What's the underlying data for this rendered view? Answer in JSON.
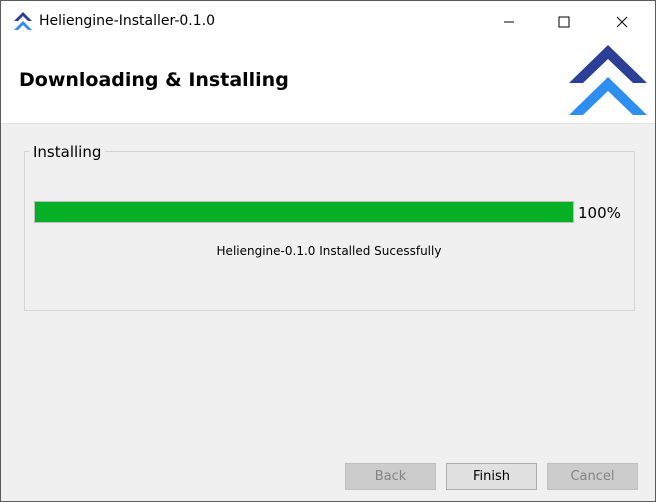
{
  "window": {
    "title": "Heliengine-Installer-0.1.0",
    "controls": {
      "minimize": "minimize-icon",
      "maximize": "maximize-icon",
      "close": "close-icon"
    }
  },
  "header": {
    "title": "Downloading & Installing",
    "logo": "heliengine-logo",
    "logo_colors": {
      "top": "#2b3f96",
      "bottom": "#2f8ff0"
    }
  },
  "install_group": {
    "legend": "Installing",
    "progress": {
      "percent": 100,
      "label": "100%"
    },
    "status_message": "Heliengine-0.1.0 Installed Sucessfully",
    "progress_color": "#06b025"
  },
  "footer": {
    "back_label": "Back",
    "finish_label": "Finish",
    "cancel_label": "Cancel",
    "back_enabled": false,
    "finish_enabled": true,
    "cancel_enabled": false
  }
}
